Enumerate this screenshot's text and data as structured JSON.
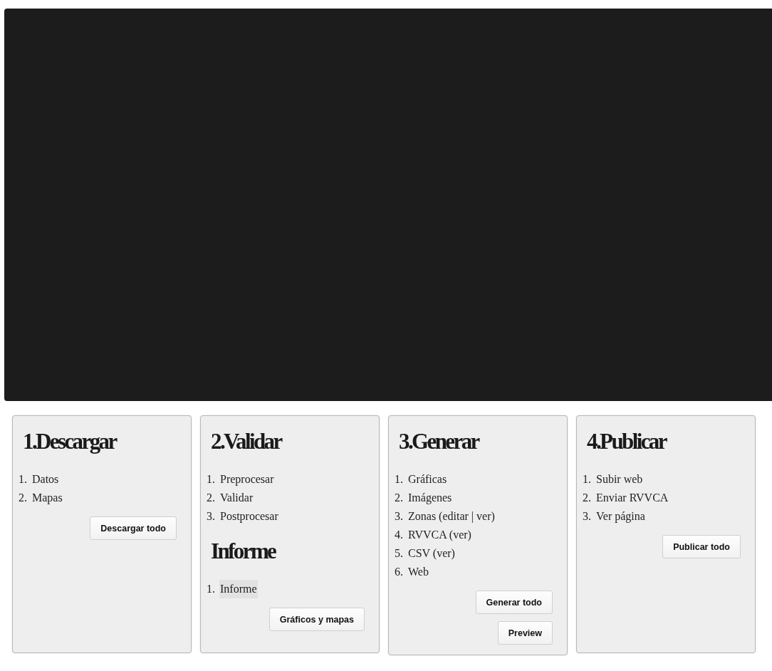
{
  "cards": [
    {
      "sections": [
        {
          "heading": "1.Descargar",
          "items": [
            {
              "number": "1.",
              "label": "Datos",
              "highlighted": false
            },
            {
              "number": "2.",
              "label": "Mapas",
              "highlighted": false
            }
          ]
        }
      ],
      "buttons": [
        "Descargar todo"
      ]
    },
    {
      "sections": [
        {
          "heading": "2.Validar",
          "items": [
            {
              "number": "1.",
              "label": "Preprocesar",
              "highlighted": false
            },
            {
              "number": "2.",
              "label": "Validar",
              "highlighted": false
            },
            {
              "number": "3.",
              "label": "Postprocesar",
              "highlighted": false
            }
          ]
        },
        {
          "heading": "Informe",
          "items": [
            {
              "number": "1.",
              "label": "Informe",
              "highlighted": true
            }
          ]
        }
      ],
      "buttons": [
        "Gráficos y mapas"
      ]
    },
    {
      "sections": [
        {
          "heading": "3.Generar",
          "items": [
            {
              "number": "1.",
              "label": "Gráficas",
              "highlighted": false
            },
            {
              "number": "2.",
              "label": "Imágenes",
              "highlighted": false
            },
            {
              "number": "3.",
              "label": "Zonas (editar | ver)",
              "highlighted": false
            },
            {
              "number": "4.",
              "label": "RVVCA (ver)",
              "highlighted": false
            },
            {
              "number": "5.",
              "label": "CSV (ver)",
              "highlighted": false
            },
            {
              "number": "6.",
              "label": "Web",
              "highlighted": false
            }
          ]
        }
      ],
      "buttons": [
        "Generar todo",
        "Preview"
      ]
    },
    {
      "sections": [
        {
          "heading": "4.Publicar",
          "items": [
            {
              "number": "1.",
              "label": "Subir web",
              "highlighted": false
            },
            {
              "number": "2.",
              "label": "Enviar RVVCA",
              "highlighted": false
            },
            {
              "number": "3.",
              "label": "Ver página",
              "highlighted": false
            }
          ]
        }
      ],
      "buttons": [
        "Publicar todo"
      ]
    }
  ]
}
